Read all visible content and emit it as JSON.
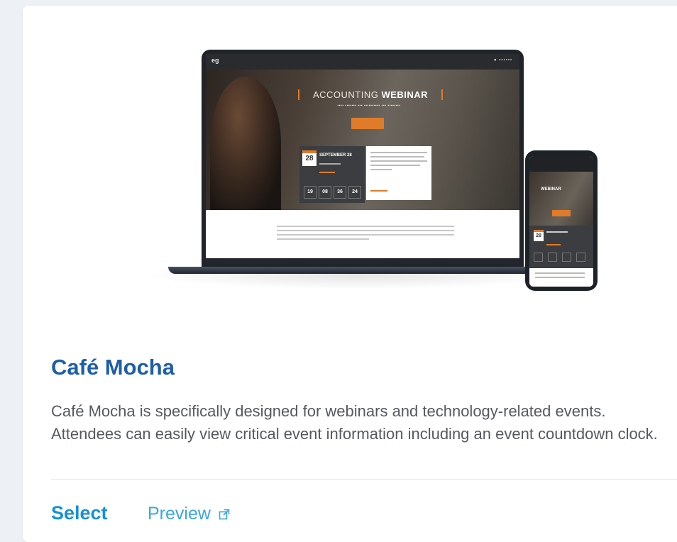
{
  "template": {
    "name": "Café Mocha",
    "description": "Café Mocha is specifically designed for webinars and technology-related events. Attendees can easily view critical event information including an event countdown clock.",
    "select_label": "Select",
    "preview_label": "Preview",
    "preview_icon": "external-link-icon"
  },
  "mockup": {
    "hero_title_light": "ACCOUNTING",
    "hero_title_bold": "WEBINAR",
    "event_date": "28",
    "event_month": "SEPTEMBER 28",
    "countdown": [
      "19",
      "08",
      "36",
      "24"
    ]
  },
  "colors": {
    "title": "#1d5ea8",
    "select": "#1591d6",
    "preview": "#3ba6e0",
    "accent": "#e07b2a"
  }
}
